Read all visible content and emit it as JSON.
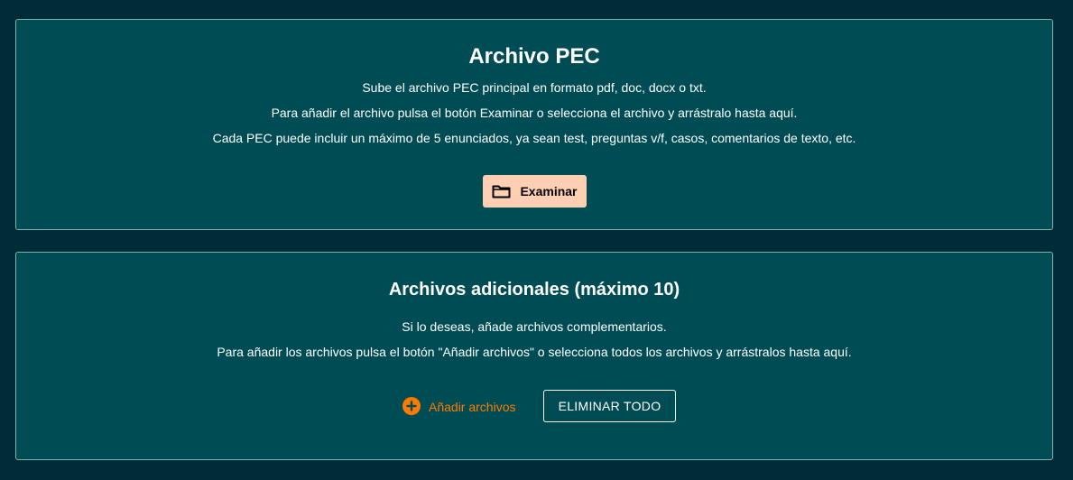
{
  "main_panel": {
    "title": "Archivo PEC",
    "line1": "Sube el archivo PEC principal en formato pdf, doc, docx o txt.",
    "line2": "Para añadir el archivo pulsa el botón Examinar o selecciona el archivo y arrástralo hasta aquí.",
    "line3": "Cada PEC puede incluir un máximo de 5 enunciados, ya sean test, preguntas v/f, casos, comentarios de texto, etc.",
    "browse_label": "Examinar",
    "browse_icon": "folder-icon"
  },
  "extra_panel": {
    "title": "Archivos adicionales (máximo 10)",
    "line1": "Si lo deseas, añade archivos complementarios.",
    "line2": "Para añadir los archivos pulsa el botón \"Añadir archivos\" o selecciona todos los archivos y arrástralos hasta aquí.",
    "add_label": "Añadir archivos",
    "add_icon": "plus-circle-icon",
    "clear_label": "ELIMINAR TODO"
  },
  "colors": {
    "page_background": "#002b38",
    "panel_background": "#004c55",
    "panel_border": "#7fb3a8",
    "browse_button": "#ffcfb3",
    "accent_orange": "#ff7a00"
  }
}
